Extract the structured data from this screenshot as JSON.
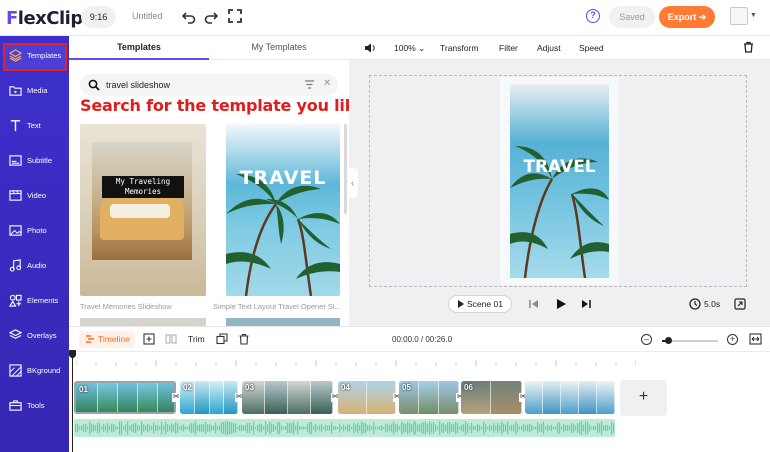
{
  "topbar": {
    "logo_prefix": "F",
    "logo_rest": "lexClip",
    "ratio": "9:16",
    "project_title": "Untitled",
    "help": "?",
    "saved_label": "Saved",
    "export_label": "Export ➔"
  },
  "sidebar": {
    "items": [
      {
        "label": "Templates",
        "icon": "layers-icon",
        "active": true
      },
      {
        "label": "Media",
        "icon": "folder-icon"
      },
      {
        "label": "Text",
        "icon": "text-icon"
      },
      {
        "label": "Subtitle",
        "icon": "subtitle-icon"
      },
      {
        "label": "Video",
        "icon": "video-icon"
      },
      {
        "label": "Photo",
        "icon": "photo-icon"
      },
      {
        "label": "Audio",
        "icon": "music-icon"
      },
      {
        "label": "Elements",
        "icon": "shapes-icon"
      },
      {
        "label": "Overlays",
        "icon": "overlay-icon"
      },
      {
        "label": "BKground",
        "icon": "background-icon"
      },
      {
        "label": "Tools",
        "icon": "toolbox-icon"
      }
    ]
  },
  "panel": {
    "tabs": [
      "Templates",
      "My Templates"
    ],
    "search": {
      "value": "travel slideshow",
      "clear": "✕"
    },
    "templates": [
      {
        "caption": "Travel Memories Slideshow",
        "overlay_text": "My Traveling\nMemories"
      },
      {
        "caption": "Simple Text Layout Travel Opener Sl...",
        "overlay_text": "TRAVEL"
      }
    ]
  },
  "annotation": {
    "text": "Search for the template you like here",
    "color": "#e01c1c"
  },
  "editor": {
    "toolbar": {
      "zoom": "100%",
      "items": [
        "Transform",
        "Filter",
        "Adjust",
        "Speed"
      ]
    },
    "preview_text": "TRAVEL",
    "scene_label": "Scene 01",
    "duration": "5.0s"
  },
  "timeline": {
    "label": "Timeline",
    "trim_label": "Trim",
    "timecode": "00:00.0 / 00:26.0",
    "clips": [
      {
        "num": "01",
        "selected": true
      },
      {
        "num": "02"
      },
      {
        "num": "03"
      },
      {
        "num": "04"
      },
      {
        "num": "05"
      },
      {
        "num": "06"
      },
      {
        "num": ""
      }
    ],
    "add": "+"
  },
  "colors": {
    "brand": "#6a45f2",
    "sidebar": "#3a2bc0",
    "export": "#ff7a32",
    "accent_orange": "#ff6a1f",
    "audio": "#5fd3a8"
  }
}
